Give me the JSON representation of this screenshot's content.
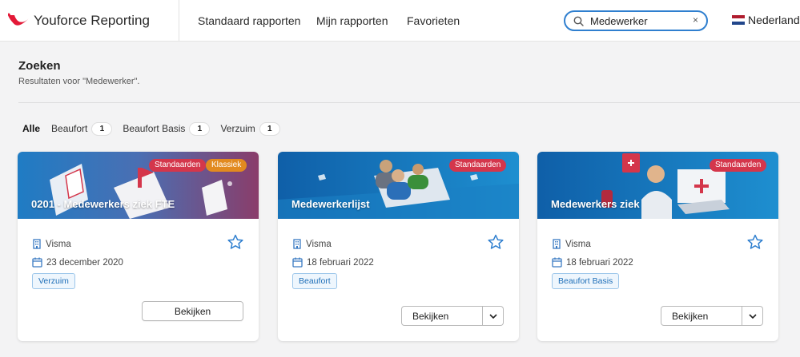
{
  "app": {
    "title": "Youforce Reporting",
    "brand_color": "#e31937",
    "accent": "#2f7fcf"
  },
  "nav": {
    "items": [
      "Standaard rapporten",
      "Mijn rapporten",
      "Favorieten"
    ]
  },
  "search": {
    "value": "Medewerker",
    "placeholder": "",
    "clear": "×",
    "icon": "search-icon"
  },
  "language": {
    "label": "Nederlands",
    "icon": "dutch-flag-icon"
  },
  "page": {
    "title": "Zoeken",
    "results": "Resultaten voor \"Medewerker\"."
  },
  "filters": [
    {
      "label": "Alle",
      "count": null,
      "active": true
    },
    {
      "label": "Beaufort",
      "count": "1"
    },
    {
      "label": "Beaufort Basis",
      "count": "1"
    },
    {
      "label": "Verzuim",
      "count": "1"
    }
  ],
  "cards": [
    {
      "title": "0201 - Medewerkers ziek FTE",
      "badges": [
        "Standaarden",
        "Klassiek"
      ],
      "source": "Visma",
      "date": "23 december 2020",
      "tag": "Verzuim",
      "button": "Bekijken"
    },
    {
      "title": "Medewerkerlijst",
      "badges": [
        "Standaarden"
      ],
      "source": "Visma",
      "date": "18 februari 2022",
      "tag": "Beaufort",
      "button": "Bekijken"
    },
    {
      "title": "Medewerkers ziek",
      "badges": [
        "Standaarden"
      ],
      "source": "Visma",
      "date": "18 februari 2022",
      "tag": "Beaufort Basis",
      "button": "Bekijken"
    }
  ]
}
